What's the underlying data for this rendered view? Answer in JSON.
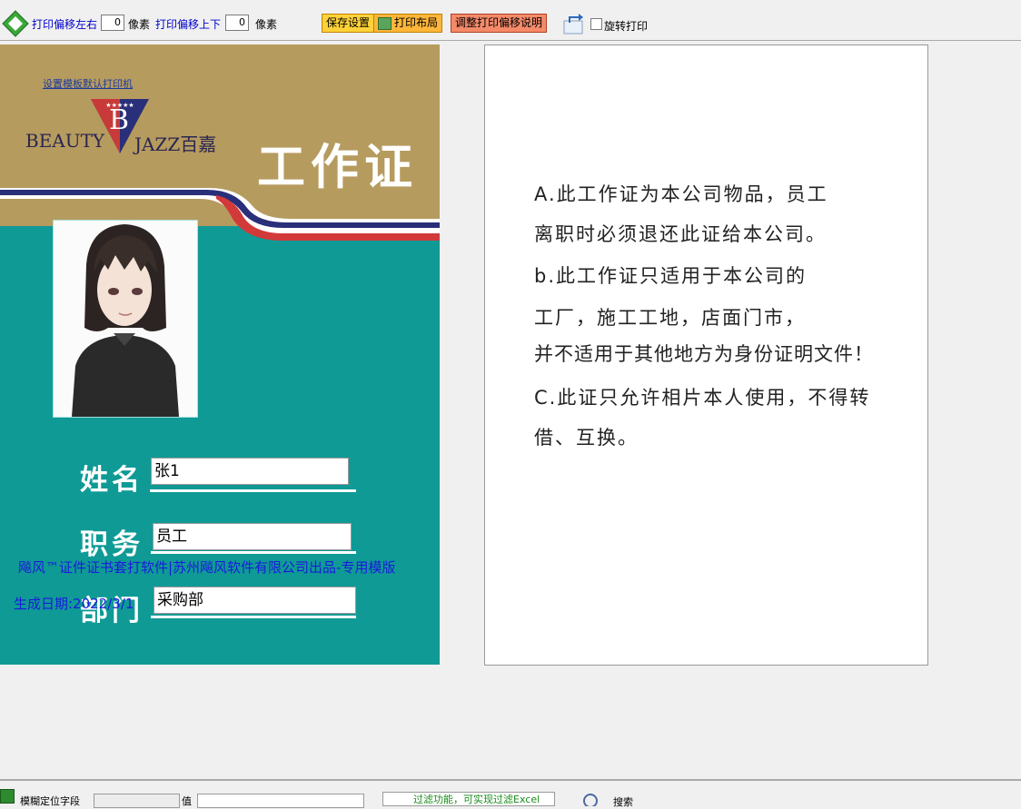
{
  "toolbar": {
    "offset_lr_label": "打印偏移左右",
    "offset_lr_value": "0",
    "unit_px_1": "像素",
    "offset_ud_label": "打印偏移上下",
    "offset_ud_value": "0",
    "unit_px_2": "像素",
    "save_settings": "保存设置",
    "print_layout": "打印布局",
    "adjust_offset_help": "调整打印偏移说明",
    "rotate_print": "旋转打印"
  },
  "card_front": {
    "set_default_printer": "设置模板默认打印机",
    "brand_left": "BEAUTY",
    "brand_right": "JAZZ百嘉",
    "brand_mark": "B",
    "title": "工作证",
    "name_label": "姓名",
    "name_value": "张1",
    "position_label": "职务",
    "position_value": "员工",
    "dept_label": "部门",
    "dept_value": "采购部",
    "watermark": "飚风™证件证书套打软件|苏州飚风软件有限公司出品-专用模版",
    "generated_date": "生成日期:2022/3/1"
  },
  "card_back": {
    "lines": [
      "A.此工作证为本公司物品，员工",
      "离职时必须退还此证给本公司。",
      "b.此工作证只适用于本公司的",
      "工厂，施工工地，店面门市，",
      "并不适用于其他地方为身份证明文件！",
      "C.此证只允许相片本人使用，不得转",
      "借、互换。"
    ]
  },
  "statusbar": {
    "fuzzy_field_label": "模糊定位字段",
    "value_label": "值",
    "filter_hint": "过滤功能，可实现过滤Excel",
    "search_label": "搜索"
  },
  "colors": {
    "card_teal": "#0f9a96",
    "card_gold": "#b69b5f",
    "stripe_navy": "#2a2f7a",
    "stripe_red": "#d23a3a",
    "link_blue": "#0000cc"
  }
}
